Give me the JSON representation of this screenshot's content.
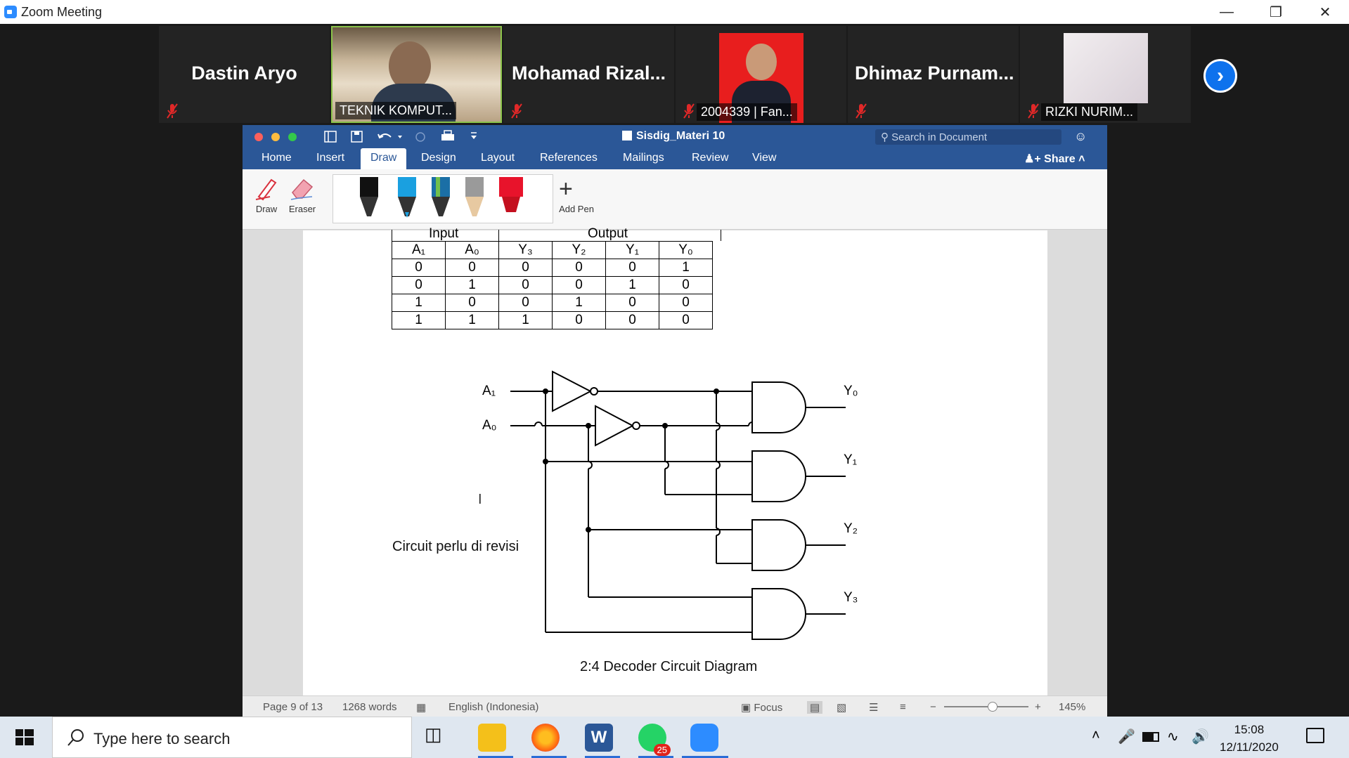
{
  "window": {
    "title": "Zoom Meeting"
  },
  "participants": [
    {
      "name": "Dastin Aryo"
    },
    {
      "name": "TEKNIK KOMPUT..."
    },
    {
      "name": "Mohamad  Rizal..."
    },
    {
      "name": "2004339 | Fan..."
    },
    {
      "name": "Dhimaz  Purnam..."
    },
    {
      "name": "RIZKI NURIM..."
    }
  ],
  "word": {
    "title": "Sisdig_Materi 10",
    "search_placeholder": "Search in Document",
    "share_label": "Share",
    "tabs": [
      "Home",
      "Insert",
      "Draw",
      "Design",
      "Layout",
      "References",
      "Mailings",
      "Review",
      "View"
    ],
    "tools": {
      "draw": "Draw",
      "eraser": "Eraser",
      "add_pen": "Add Pen"
    },
    "pen_colors": [
      "#111111",
      "#1aa0e0",
      "#1b6fa6",
      "#9a9a9a",
      "#e8132b"
    ]
  },
  "document": {
    "table_group_headers": [
      "Input",
      "Output"
    ],
    "table_headers": [
      "A₁",
      "A₀",
      "Y₃",
      "Y₂",
      "Y₁",
      "Y₀"
    ],
    "table_rows": [
      [
        "0",
        "0",
        "0",
        "0",
        "0",
        "1"
      ],
      [
        "0",
        "1",
        "0",
        "0",
        "1",
        "0"
      ],
      [
        "1",
        "0",
        "0",
        "1",
        "0",
        "0"
      ],
      [
        "1",
        "1",
        "1",
        "0",
        "0",
        "0"
      ]
    ],
    "inputs": [
      "A₁",
      "A₀"
    ],
    "outputs": [
      "Y₀",
      "Y₁",
      "Y₂",
      "Y₃"
    ],
    "note": "Circuit perlu di revisi",
    "caption": "2:4 Decoder Circuit Diagram"
  },
  "statusbar": {
    "page": "Page 9 of 13",
    "words": "1268 words",
    "language": "English (Indonesia)",
    "focus": "Focus",
    "zoom": "145%"
  },
  "taskbar": {
    "search_placeholder": "Type here to search",
    "whatsapp_badge": "25",
    "time": "15:08",
    "date": "12/11/2020"
  }
}
